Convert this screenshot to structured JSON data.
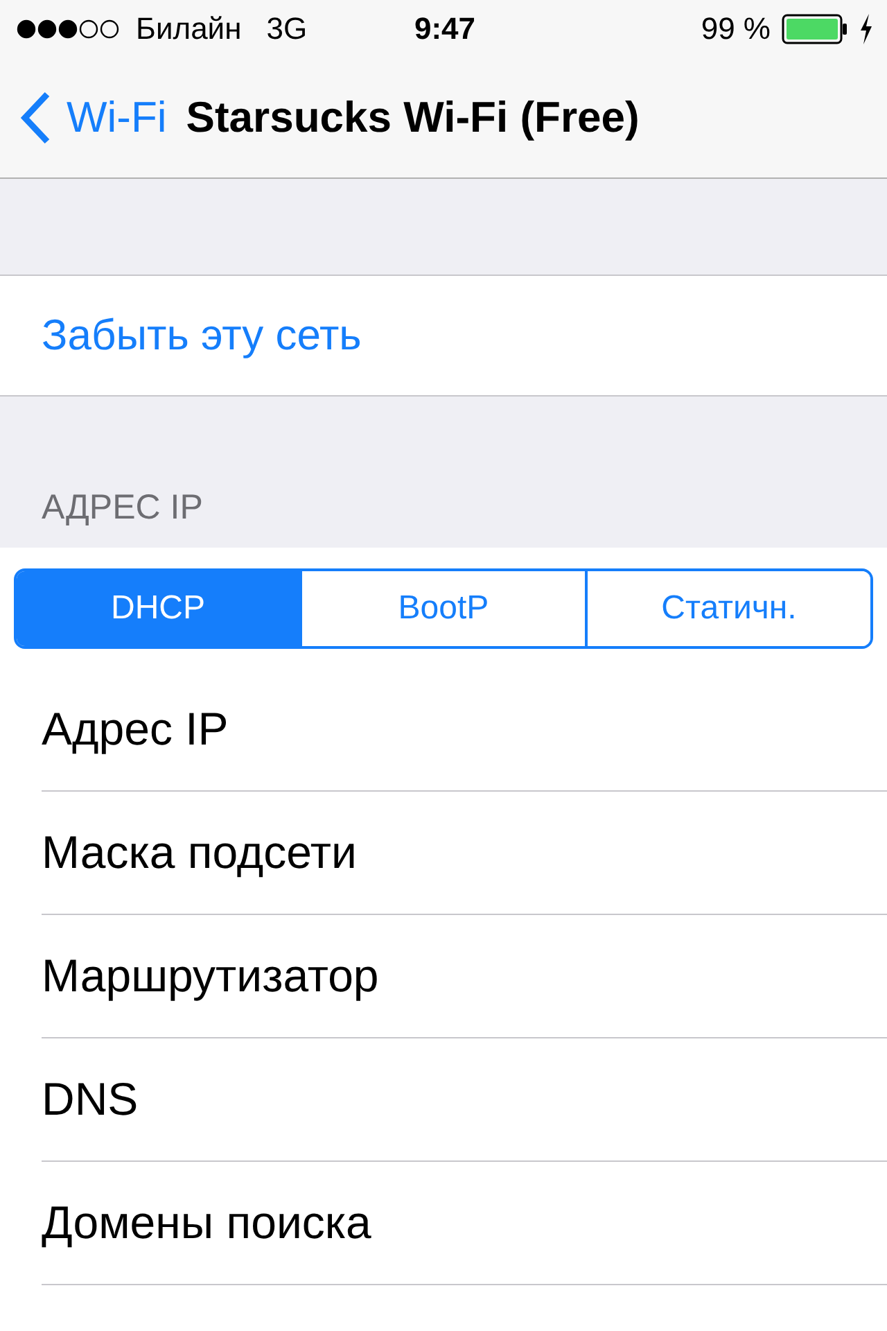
{
  "status_bar": {
    "carrier": "Билайн",
    "network": "3G",
    "time": "9:47",
    "battery_percent": "99 %",
    "charging": true
  },
  "nav_bar": {
    "back_label": "Wi-Fi",
    "title": "Starsucks Wi-Fi (Free)"
  },
  "forget_action": "Забыть эту сеть",
  "section_header": "АДРЕС IP",
  "segments": [
    {
      "label": "DHCP",
      "selected": true
    },
    {
      "label": "BootP",
      "selected": false
    },
    {
      "label": "Статичн.",
      "selected": false
    }
  ],
  "rows": [
    {
      "label": "Адрес IP"
    },
    {
      "label": "Маска подсети"
    },
    {
      "label": "Маршрутизатор"
    },
    {
      "label": "DNS"
    },
    {
      "label": "Домены поиска"
    }
  ]
}
